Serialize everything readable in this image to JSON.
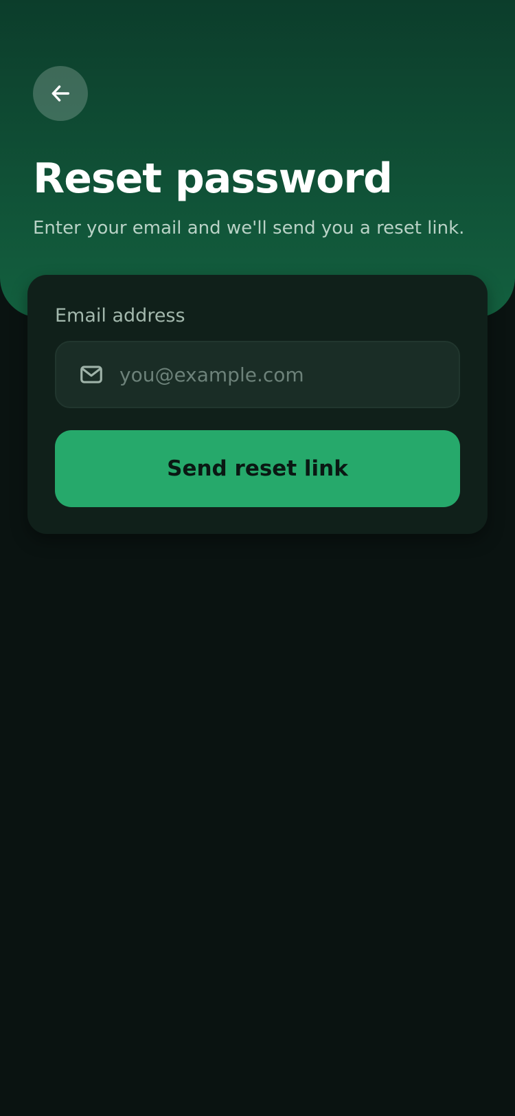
{
  "header": {
    "back_icon": "arrow-left-icon",
    "title": "Reset password",
    "subtitle": "Enter your email and we'll send you a reset link."
  },
  "form": {
    "email_label": "Email address",
    "email_icon": "mail-icon",
    "email_value": "",
    "email_placeholder": "you@example.com",
    "submit_label": "Send reset link"
  },
  "colors": {
    "hero_top": "#0c3d2b",
    "hero_bottom": "#13603f",
    "background": "#0a1311",
    "card": "#10201a",
    "input": "#1a2d26",
    "accent": "#26a96b"
  }
}
